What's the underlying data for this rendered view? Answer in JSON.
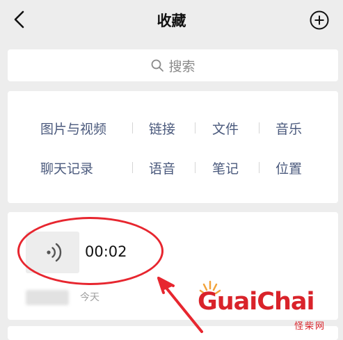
{
  "header": {
    "title": "收藏",
    "back_icon": "chevron-left-icon",
    "add_icon": "plus-circle-icon"
  },
  "search": {
    "placeholder": "搜索",
    "icon": "search-icon"
  },
  "categories": {
    "row1": [
      "图片与视频",
      "链接",
      "文件",
      "音乐"
    ],
    "row2": [
      "聊天记录",
      "语音",
      "笔记",
      "位置"
    ]
  },
  "favorite_item": {
    "type_icon": "voice-icon",
    "duration": "00:02",
    "date": "今天"
  },
  "watermark": {
    "brand": "GuaiChai",
    "subtitle": "怪柴网"
  },
  "colors": {
    "background": "#ededed",
    "card": "#ffffff",
    "category_text": "#4b5a7d",
    "annotation_red": "#e7262f"
  }
}
